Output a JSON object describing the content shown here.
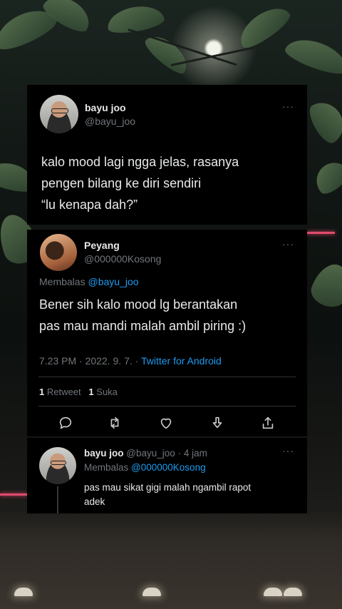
{
  "tweet1": {
    "name": "bayu joo",
    "handle": "@bayu_joo",
    "more": "···",
    "line1": "kalo mood lagi ngga jelas, rasanya",
    "line2": "pengen bilang ke diri sendiri",
    "line3": "“lu kenapa dah?”"
  },
  "tweet2": {
    "name": "Peyang",
    "handle": "@000000Kosong",
    "more": "···",
    "replying_label": "Membalas",
    "replying_to": "@bayu_joo",
    "line1": "Bener sih kalo mood lg berantakan",
    "line2": "pas mau mandi malah ambil piring :)",
    "time": "7.23 PM",
    "date": "2022. 9. 7.",
    "source": "Twitter for Android",
    "retweet_count": "1",
    "retweet_label": "Retweet",
    "like_count": "1",
    "like_label": "Suka",
    "actions": [
      "reply-icon",
      "retweet-icon",
      "like-icon",
      "bookmark-icon",
      "share-icon"
    ]
  },
  "tweet3": {
    "name": "bayu joo",
    "handle": "@bayu_joo",
    "age": "4 jam",
    "more": "···",
    "replying_label": "Membalas",
    "replying_to": "@000000Kosong",
    "line1": "pas mau sikat gigi malah ngambil rapot",
    "line2": "adek"
  },
  "colors": {
    "card_bg": "#000000",
    "text": "#e7e9ea",
    "muted": "#71767b",
    "link": "#1d9bf0"
  }
}
